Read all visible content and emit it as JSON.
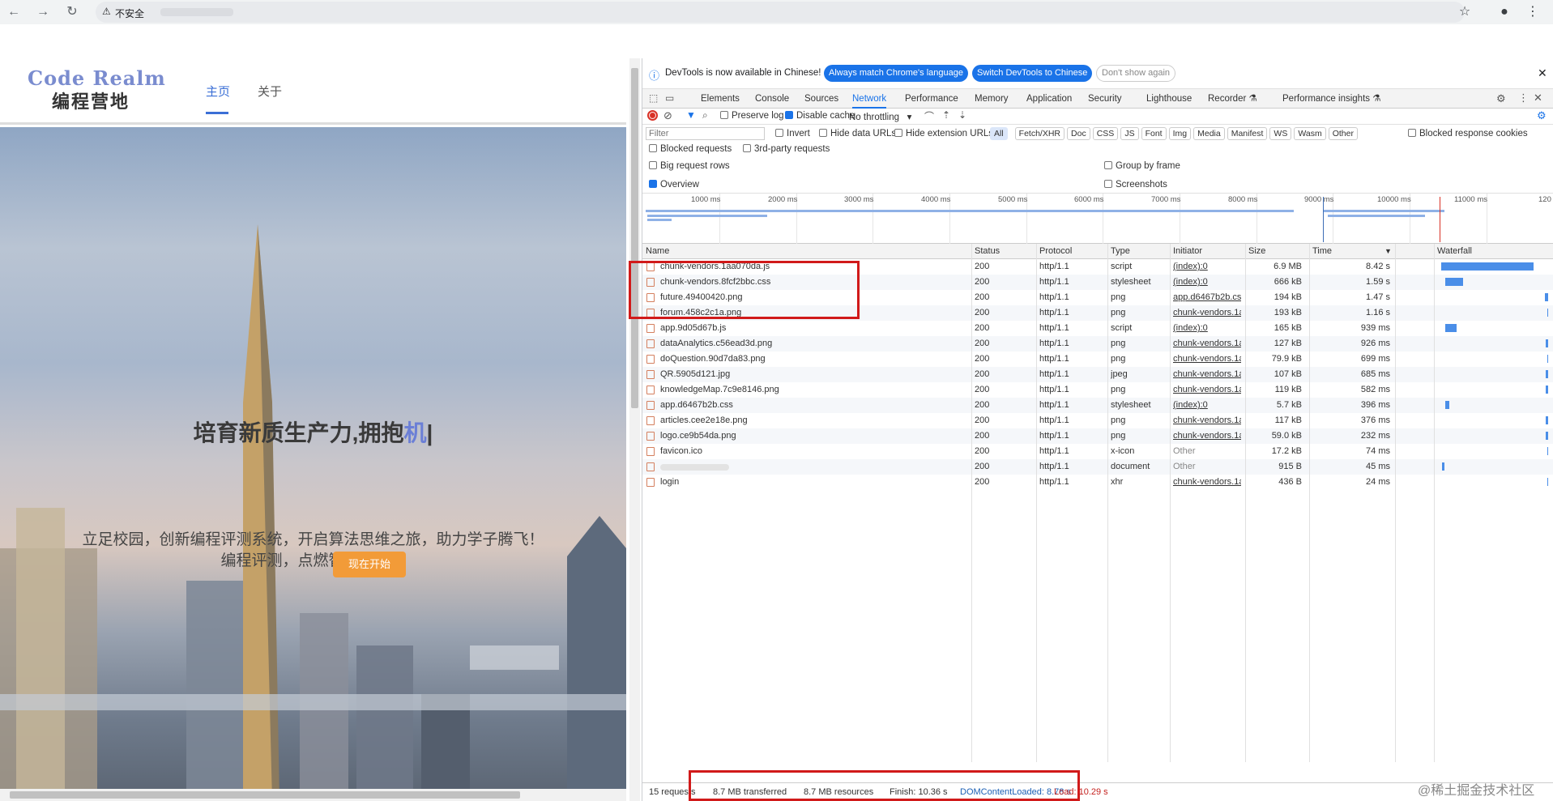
{
  "browser": {
    "security_text": "不安全"
  },
  "site": {
    "logo_en": "Code Realm",
    "logo_cn": "编程营地",
    "nav": [
      "主页",
      "关于"
    ],
    "hero_title_main": "培育新质生产力,拥抱",
    "hero_title_hl": "机",
    "hero_sub1": "立足校园，创新编程评测系统，开启算法思维之旅，助力学子腾飞！",
    "hero_sub2": "编程评测，点燃智慧之光！",
    "cta": "现在开始"
  },
  "devtools": {
    "info_text": "DevTools is now available in Chinese!",
    "btn_always": "Always match Chrome's language",
    "btn_switch": "Switch DevTools to Chinese",
    "btn_dont": "Don't show again",
    "tabs": [
      "Elements",
      "Console",
      "Sources",
      "Network",
      "Performance",
      "Memory",
      "Application",
      "Security",
      "Lighthouse",
      "Recorder ⚗",
      "Performance insights ⚗"
    ],
    "toolbar": {
      "preserve_log": "Preserve log",
      "disable_cache": "Disable cache",
      "throttle": "No throttling"
    },
    "filter_placeholder": "Filter",
    "filters": {
      "invert": "Invert",
      "hide_data": "Hide data URLs",
      "hide_ext": "Hide extension URLs",
      "chips": [
        "All",
        "Fetch/XHR",
        "Doc",
        "CSS",
        "JS",
        "Font",
        "Img",
        "Media",
        "Manifest",
        "WS",
        "Wasm",
        "Other"
      ],
      "blocked_cookies": "Blocked response cookies",
      "blocked_req": "Blocked requests",
      "third_party": "3rd-party requests",
      "big_rows": "Big request rows",
      "group_frame": "Group by frame",
      "overview": "Overview",
      "screenshots": "Screenshots"
    },
    "ticks": [
      "1000 ms",
      "2000 ms",
      "3000 ms",
      "4000 ms",
      "5000 ms",
      "6000 ms",
      "7000 ms",
      "8000 ms",
      "9000 ms",
      "10000 ms",
      "11000 ms",
      "120"
    ],
    "columns": {
      "name": "Name",
      "status": "Status",
      "protocol": "Protocol",
      "type": "Type",
      "initiator": "Initiator",
      "size": "Size",
      "time": "Time",
      "waterfall": "Waterfall"
    },
    "rows": [
      {
        "name": "chunk-vendors.1aa070da.js",
        "status": "200",
        "protocol": "http/1.1",
        "type": "script",
        "initiator": "(index):0",
        "size": "6.9 MB",
        "time": "8.42 s",
        "wf_start": 0.02,
        "wf_len": 0.85
      },
      {
        "name": "chunk-vendors.8fcf2bbc.css",
        "status": "200",
        "protocol": "http/1.1",
        "type": "stylesheet",
        "initiator": "(index):0",
        "size": "666 kB",
        "time": "1.59 s",
        "wf_start": 0.06,
        "wf_len": 0.16
      },
      {
        "name": "future.49400420.png",
        "status": "200",
        "protocol": "http/1.1",
        "type": "png",
        "initiator": "app.d6467b2b.cs",
        "size": "194 kB",
        "time": "1.47 s",
        "wf_start": 0.97,
        "wf_len": 0.03
      },
      {
        "name": "forum.458c2c1a.png",
        "status": "200",
        "protocol": "http/1.1",
        "type": "png",
        "initiator": "chunk-vendors.1a",
        "size": "193 kB",
        "time": "1.16 s",
        "wf_start": 0.99,
        "wf_len": 0.01
      },
      {
        "name": "app.9d05d67b.js",
        "status": "200",
        "protocol": "http/1.1",
        "type": "script",
        "initiator": "(index):0",
        "size": "165 kB",
        "time": "939 ms",
        "wf_start": 0.06,
        "wf_len": 0.1
      },
      {
        "name": "dataAnalytics.c56ead3d.png",
        "status": "200",
        "protocol": "http/1.1",
        "type": "png",
        "initiator": "chunk-vendors.1a",
        "size": "127 kB",
        "time": "926 ms",
        "wf_start": 0.98,
        "wf_len": 0.02
      },
      {
        "name": "doQuestion.90d7da83.png",
        "status": "200",
        "protocol": "http/1.1",
        "type": "png",
        "initiator": "chunk-vendors.1a",
        "size": "79.9 kB",
        "time": "699 ms",
        "wf_start": 0.99,
        "wf_len": 0.01
      },
      {
        "name": "QR.5905d121.jpg",
        "status": "200",
        "protocol": "http/1.1",
        "type": "jpeg",
        "initiator": "chunk-vendors.1a",
        "size": "107 kB",
        "time": "685 ms",
        "wf_start": 0.98,
        "wf_len": 0.02
      },
      {
        "name": "knowledgeMap.7c9e8146.png",
        "status": "200",
        "protocol": "http/1.1",
        "type": "png",
        "initiator": "chunk-vendors.1a",
        "size": "119 kB",
        "time": "582 ms",
        "wf_start": 0.98,
        "wf_len": 0.02
      },
      {
        "name": "app.d6467b2b.css",
        "status": "200",
        "protocol": "http/1.1",
        "type": "stylesheet",
        "initiator": "(index):0",
        "size": "5.7 kB",
        "time": "396 ms",
        "wf_start": 0.06,
        "wf_len": 0.04
      },
      {
        "name": "articles.cee2e18e.png",
        "status": "200",
        "protocol": "http/1.1",
        "type": "png",
        "initiator": "chunk-vendors.1a",
        "size": "117 kB",
        "time": "376 ms",
        "wf_start": 0.98,
        "wf_len": 0.02
      },
      {
        "name": "logo.ce9b54da.png",
        "status": "200",
        "protocol": "http/1.1",
        "type": "png",
        "initiator": "chunk-vendors.1a",
        "size": "59.0 kB",
        "time": "232 ms",
        "wf_start": 0.98,
        "wf_len": 0.02
      },
      {
        "name": "favicon.ico",
        "status": "200",
        "protocol": "http/1.1",
        "type": "x-icon",
        "initiator": "Other",
        "size": "17.2 kB",
        "time": "74 ms",
        "wf_start": 0.99,
        "wf_len": 0.01
      },
      {
        "name": "",
        "status": "200",
        "protocol": "http/1.1",
        "type": "document",
        "initiator": "Other",
        "size": "915 B",
        "time": "45 ms",
        "wf_start": 0.03,
        "wf_len": 0.01
      },
      {
        "name": "login",
        "status": "200",
        "protocol": "http/1.1",
        "type": "xhr",
        "initiator": "chunk-vendors.1a",
        "size": "436 B",
        "time": "24 ms",
        "wf_start": 0.99,
        "wf_len": 0.01
      }
    ],
    "status": {
      "requests": "15 requests",
      "transferred": "8.7 MB transferred",
      "resources": "8.7 MB resources",
      "finish": "Finish: 10.36 s",
      "dcl": "DOMContentLoaded: 8.78 s",
      "load": "Load: 10.29 s"
    }
  },
  "watermark": "@稀土掘金技术社区"
}
